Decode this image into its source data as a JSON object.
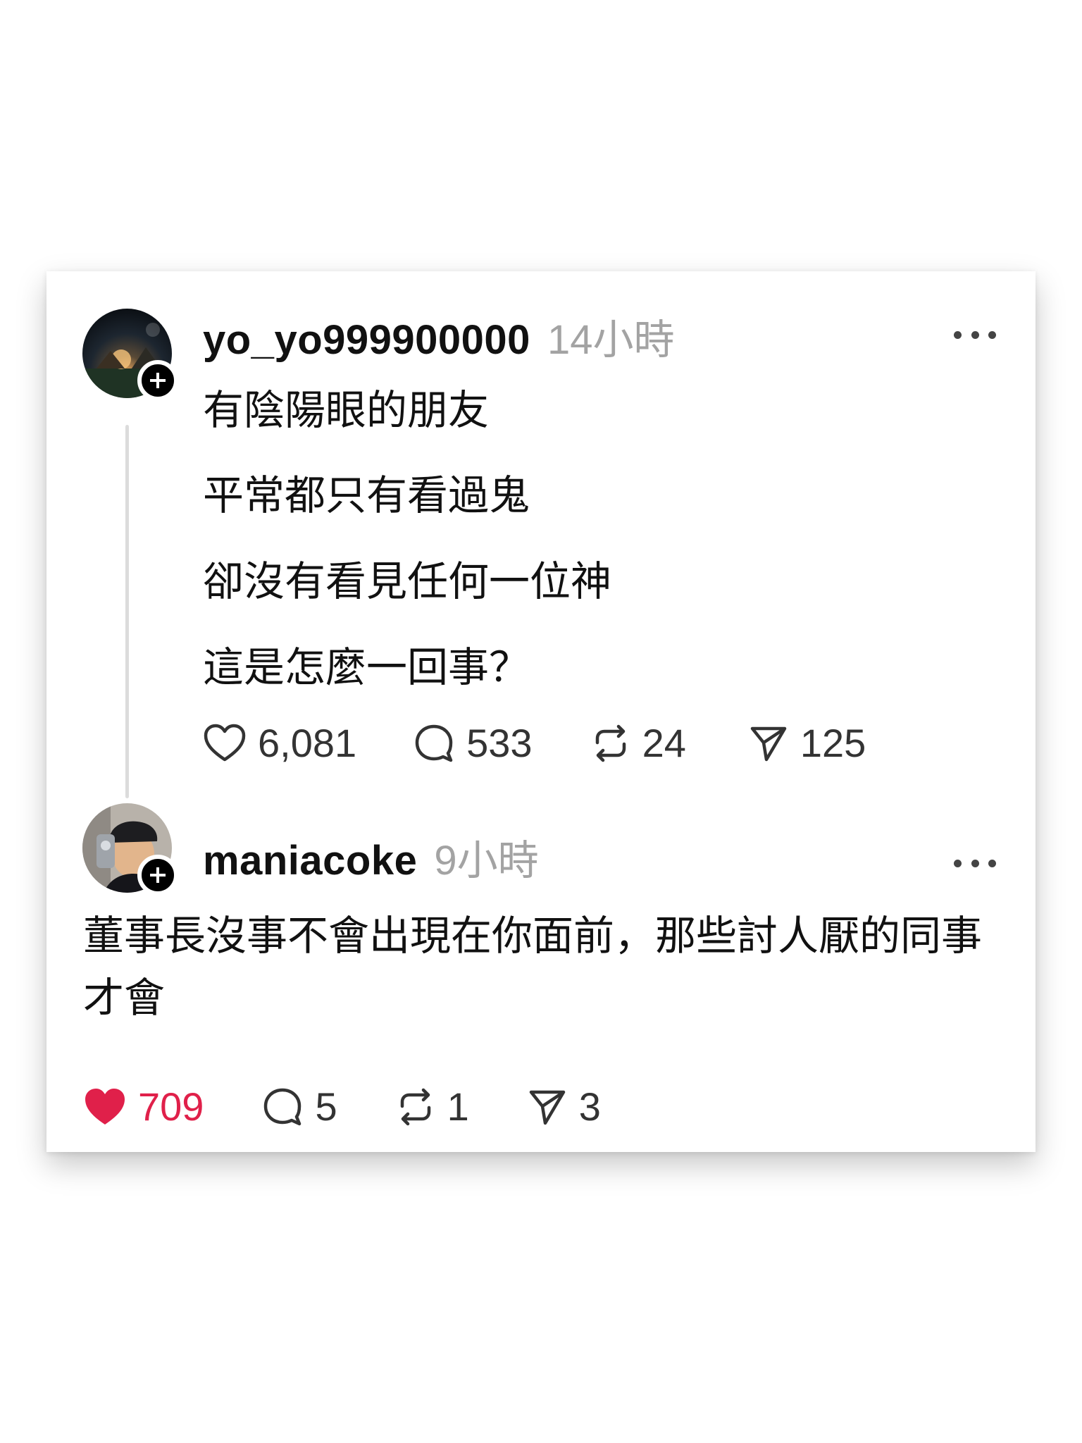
{
  "posts": [
    {
      "username": "yo_yo999900000",
      "time": "14小時",
      "avatar_icon": "night-camp-photo",
      "lines": [
        "有陰陽眼的朋友",
        "平常都只有看過鬼",
        "卻沒有看見任何一位神",
        "這是怎麼一回事？"
      ],
      "likes": "6,081",
      "comments": "533",
      "reposts": "24",
      "shares": "125",
      "liked": false
    },
    {
      "username": "maniacoke",
      "time": "9小時",
      "avatar_icon": "man-with-cap-photo",
      "text": "董事長沒事不會出現在你面前，那些討人厭的同事才會",
      "likes": "709",
      "comments": "5",
      "reposts": "1",
      "shares": "3",
      "liked": true
    }
  ],
  "colors": {
    "like_active": "#e0204a",
    "time_gray": "#a3a3a3",
    "thread_line": "#dcdcdc"
  }
}
